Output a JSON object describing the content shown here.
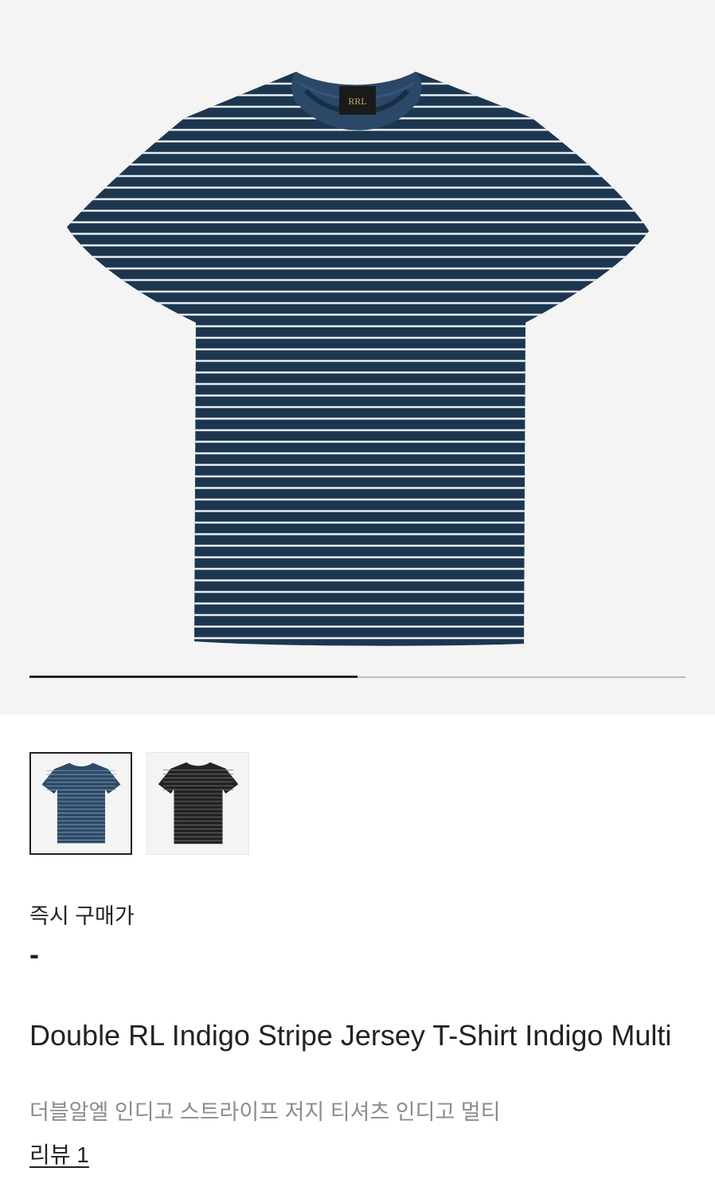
{
  "gallery": {
    "image_alt": "Double RL Indigo Stripe Jersey T-Shirt",
    "progress": 0.5,
    "colors": {
      "shirt": "#1d3650",
      "stripe": "#e8edf2",
      "track": "#bdbdbd",
      "fill": "#222222",
      "background": "#f4f4f4"
    }
  },
  "thumbnails": [
    {
      "name": "indigo",
      "color": "#2d4a68",
      "selected": true
    },
    {
      "name": "black",
      "color": "#232323",
      "selected": false
    }
  ],
  "price": {
    "label": "즉시 구매가",
    "value": "-"
  },
  "product": {
    "title": "Double RL Indigo Stripe Jersey T-Shirt Indigo Multi",
    "subtitle": "더블알엘 인디고 스트라이프 저지 티셔츠 인디고 멀티",
    "review_link": "리뷰 1"
  }
}
